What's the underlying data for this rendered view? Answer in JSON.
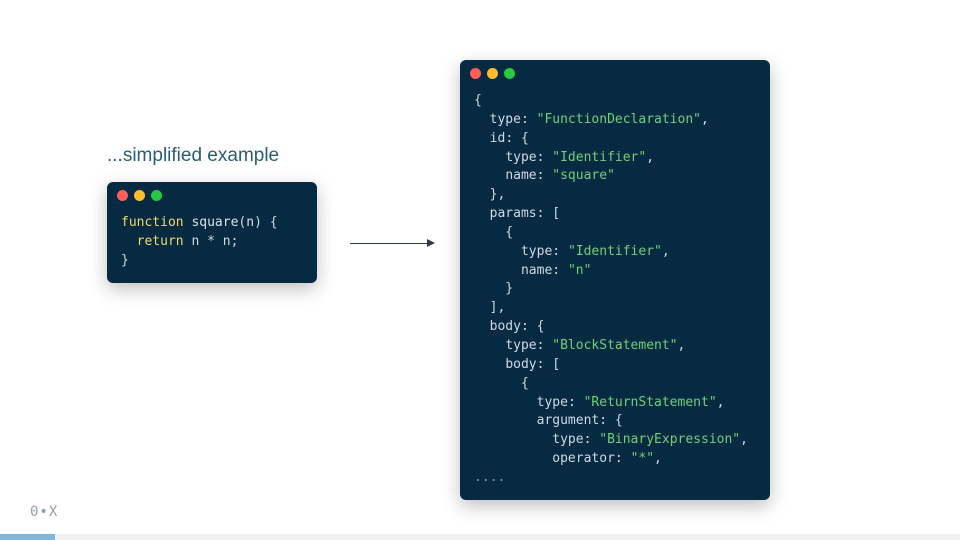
{
  "caption": "...simplified example",
  "left_window": {
    "code_tokens": [
      [
        {
          "t": "function",
          "c": "k"
        },
        {
          "t": " ",
          "c": "pt"
        },
        {
          "t": "square",
          "c": "fn"
        },
        {
          "t": "(",
          "c": "pt"
        },
        {
          "t": "n",
          "c": "id"
        },
        {
          "t": ") {",
          "c": "pt"
        }
      ],
      [
        {
          "t": "  ",
          "c": "pt"
        },
        {
          "t": "return",
          "c": "k"
        },
        {
          "t": " n * n;",
          "c": "pt"
        }
      ],
      [
        {
          "t": "}",
          "c": "pt"
        }
      ]
    ]
  },
  "right_window": {
    "code_tokens": [
      [
        {
          "t": "{",
          "c": "pt"
        }
      ],
      [
        {
          "t": "  ",
          "c": "pt"
        },
        {
          "t": "type",
          "c": "key"
        },
        {
          "t": ": ",
          "c": "pt"
        },
        {
          "t": "\"FunctionDeclaration\"",
          "c": "str"
        },
        {
          "t": ",",
          "c": "pt"
        }
      ],
      [
        {
          "t": "  ",
          "c": "pt"
        },
        {
          "t": "id",
          "c": "key"
        },
        {
          "t": ": {",
          "c": "pt"
        }
      ],
      [
        {
          "t": "    ",
          "c": "pt"
        },
        {
          "t": "type",
          "c": "key"
        },
        {
          "t": ": ",
          "c": "pt"
        },
        {
          "t": "\"Identifier\"",
          "c": "str"
        },
        {
          "t": ",",
          "c": "pt"
        }
      ],
      [
        {
          "t": "    ",
          "c": "pt"
        },
        {
          "t": "name",
          "c": "key"
        },
        {
          "t": ": ",
          "c": "pt"
        },
        {
          "t": "\"square\"",
          "c": "str"
        }
      ],
      [
        {
          "t": "  },",
          "c": "pt"
        }
      ],
      [
        {
          "t": "  ",
          "c": "pt"
        },
        {
          "t": "params",
          "c": "key"
        },
        {
          "t": ": [",
          "c": "pt"
        }
      ],
      [
        {
          "t": "    {",
          "c": "pt"
        }
      ],
      [
        {
          "t": "      ",
          "c": "pt"
        },
        {
          "t": "type",
          "c": "key"
        },
        {
          "t": ": ",
          "c": "pt"
        },
        {
          "t": "\"Identifier\"",
          "c": "str"
        },
        {
          "t": ",",
          "c": "pt"
        }
      ],
      [
        {
          "t": "      ",
          "c": "pt"
        },
        {
          "t": "name",
          "c": "key"
        },
        {
          "t": ": ",
          "c": "pt"
        },
        {
          "t": "\"n\"",
          "c": "str"
        }
      ],
      [
        {
          "t": "    }",
          "c": "pt"
        }
      ],
      [
        {
          "t": "  ],",
          "c": "pt"
        }
      ],
      [
        {
          "t": "  ",
          "c": "pt"
        },
        {
          "t": "body",
          "c": "key"
        },
        {
          "t": ": {",
          "c": "pt"
        }
      ],
      [
        {
          "t": "    ",
          "c": "pt"
        },
        {
          "t": "type",
          "c": "key"
        },
        {
          "t": ": ",
          "c": "pt"
        },
        {
          "t": "\"BlockStatement\"",
          "c": "str"
        },
        {
          "t": ",",
          "c": "pt"
        }
      ],
      [
        {
          "t": "    ",
          "c": "pt"
        },
        {
          "t": "body",
          "c": "key"
        },
        {
          "t": ": [",
          "c": "pt"
        }
      ],
      [
        {
          "t": "      {",
          "c": "pt"
        }
      ],
      [
        {
          "t": "        ",
          "c": "pt"
        },
        {
          "t": "type",
          "c": "key"
        },
        {
          "t": ": ",
          "c": "pt"
        },
        {
          "t": "\"ReturnStatement\"",
          "c": "str"
        },
        {
          "t": ",",
          "c": "pt"
        }
      ],
      [
        {
          "t": "        ",
          "c": "pt"
        },
        {
          "t": "argument",
          "c": "key"
        },
        {
          "t": ": {",
          "c": "pt"
        }
      ],
      [
        {
          "t": "          ",
          "c": "pt"
        },
        {
          "t": "type",
          "c": "key"
        },
        {
          "t": ": ",
          "c": "pt"
        },
        {
          "t": "\"BinaryExpression\"",
          "c": "str"
        },
        {
          "t": ",",
          "c": "pt"
        }
      ],
      [
        {
          "t": "          ",
          "c": "pt"
        },
        {
          "t": "operator",
          "c": "key"
        },
        {
          "t": ": ",
          "c": "pt"
        },
        {
          "t": "\"*\"",
          "c": "str"
        },
        {
          "t": ",",
          "c": "pt"
        }
      ],
      [
        {
          "t": "....",
          "c": "dim"
        }
      ]
    ]
  },
  "footer_logo": "0•X"
}
